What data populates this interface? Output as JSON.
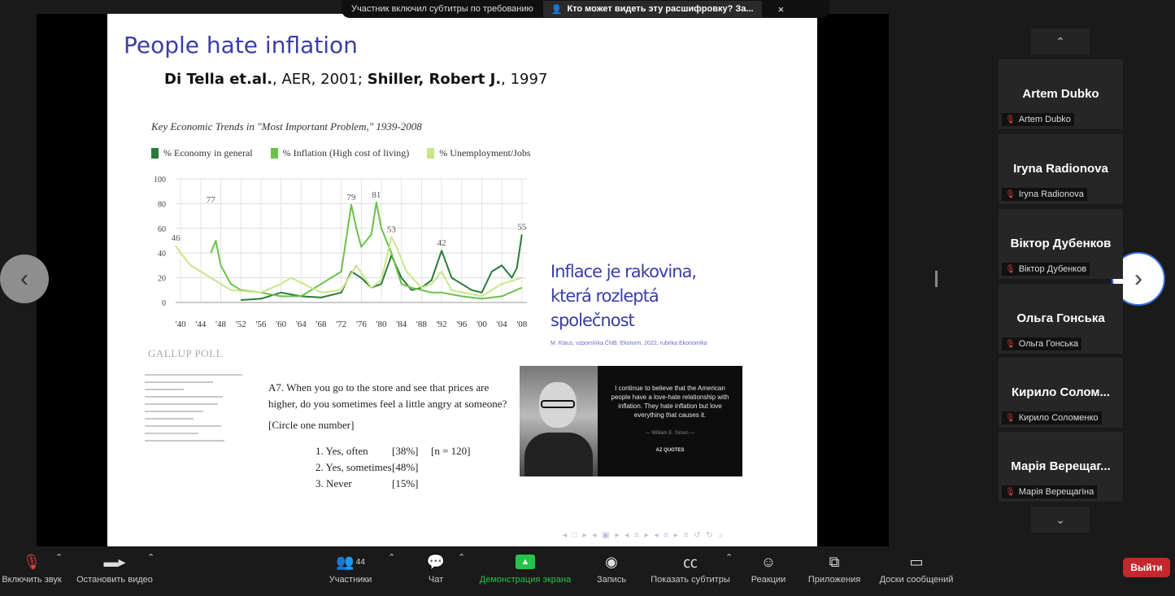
{
  "topbar": {
    "captions_notice": "Участник включил субтитры по требованию",
    "transcript_who": "Кто может видеть эту расшифровку? За...",
    "close": "×"
  },
  "slide": {
    "title": "People hate inflation",
    "subtitle_a1": "Di Tella et.al.",
    "subtitle_a2": ", AER, 2001; ",
    "subtitle_b1": "Shiller, Robert J.",
    "subtitle_b2": ", 1997",
    "gallup": "GALLUP POLL",
    "survey_q": "A7. When you go to the store and see that prices are higher, do you sometimes feel a little angry at someone?",
    "survey_instr": "[Circle one number]",
    "survey_opts": [
      {
        "label": "1. Yes, often",
        "pct": "[38%]",
        "n": "[n = 120]"
      },
      {
        "label": "2. Yes, sometimes",
        "pct": "[48%]",
        "n": ""
      },
      {
        "label": "3. Never",
        "pct": "[15%]",
        "n": ""
      }
    ],
    "czech_quote": "Inflace je rakovina, která rozleptá společnost",
    "czech_source": "M. Klaus, vzpomínka ČNB, Ekonom, 2022, rubrika Ekonomika",
    "quote_text": "I continue to believe that the American people have a love-hate relationship with inflation. They hate inflation but love everything that causes it.",
    "quote_author": "— William E. Simon —",
    "quote_brand": "AZ QUOTES"
  },
  "chart_data": {
    "type": "line",
    "title": "Key Economic Trends in \"Most Important Problem,\" 1939-2008",
    "series_colors": [
      "#2b7a3a",
      "#6cc04a",
      "#c8e68a"
    ],
    "series": [
      {
        "name": "% Economy in general",
        "x": [
          1952,
          1956,
          1960,
          1964,
          1968,
          1972,
          1974,
          1976,
          1978,
          1980,
          1982,
          1984,
          1986,
          1988,
          1990,
          1991,
          1992,
          1994,
          1996,
          1998,
          2000,
          2002,
          2004,
          2006,
          2007,
          2008
        ],
        "values": [
          2,
          3,
          8,
          5,
          4,
          8,
          25,
          20,
          12,
          15,
          38,
          20,
          10,
          12,
          18,
          30,
          42,
          20,
          15,
          10,
          8,
          25,
          30,
          20,
          28,
          55
        ]
      },
      {
        "name": "% Inflation (High cost of living)",
        "x": [
          1946,
          1947,
          1948,
          1950,
          1952,
          1956,
          1960,
          1964,
          1968,
          1972,
          1974,
          1975,
          1976,
          1978,
          1979,
          1980,
          1982,
          1984,
          1986,
          1988,
          1990,
          1992,
          1996,
          2000,
          2004,
          2008
        ],
        "values": [
          40,
          50,
          30,
          15,
          10,
          8,
          5,
          5,
          15,
          25,
          79,
          60,
          45,
          55,
          81,
          60,
          40,
          15,
          12,
          10,
          8,
          8,
          5,
          3,
          5,
          12
        ]
      },
      {
        "name": "% Unemployment/Jobs",
        "x": [
          1939,
          1940,
          1942,
          1946,
          1950,
          1956,
          1960,
          1962,
          1968,
          1972,
          1975,
          1978,
          1980,
          1982,
          1983,
          1985,
          1988,
          1990,
          1992,
          1994,
          2000,
          2004,
          2008
        ],
        "values": [
          46,
          40,
          30,
          20,
          10,
          8,
          15,
          20,
          8,
          10,
          30,
          12,
          18,
          53,
          45,
          25,
          12,
          15,
          25,
          10,
          5,
          15,
          20
        ]
      }
    ],
    "annotations": [
      {
        "x": 1939,
        "y": 46,
        "label": "46"
      },
      {
        "x": 1946,
        "y": 77,
        "label": "77"
      },
      {
        "x": 1974,
        "y": 79,
        "label": "79"
      },
      {
        "x": 1979,
        "y": 81,
        "label": "81"
      },
      {
        "x": 1982,
        "y": 53,
        "label": "53"
      },
      {
        "x": 1992,
        "y": 42,
        "label": "42"
      },
      {
        "x": 2008,
        "y": 55,
        "label": "55"
      }
    ],
    "xticks": [
      "'40",
      "'44",
      "'48",
      "'52",
      "'56",
      "'60",
      "'64",
      "'68",
      "'72",
      "'76",
      "'80",
      "'84",
      "'88",
      "'92",
      "'96",
      "'00",
      "'04",
      "'08"
    ],
    "xtick_years": [
      1940,
      1944,
      1948,
      1952,
      1956,
      1960,
      1964,
      1968,
      1972,
      1976,
      1980,
      1984,
      1988,
      1992,
      1996,
      2000,
      2004,
      2008
    ],
    "yticks": [
      0,
      20,
      40,
      60,
      80,
      100
    ],
    "xlim": [
      1939,
      2009
    ],
    "ylim": [
      0,
      100
    ],
    "grid": true
  },
  "participants": [
    {
      "display": "Artem Dubko",
      "tag": "Artem Dubko"
    },
    {
      "display": "Iryna Radionova",
      "tag": "Iryna Radionova"
    },
    {
      "display": "Віктор Дубенков",
      "tag": "Віктор Дубенков"
    },
    {
      "display": "Ольга Гонська",
      "tag": "Ольга Гонська"
    },
    {
      "display": "Кирило Солом...",
      "tag": "Кирило Соломенко"
    },
    {
      "display": "Марія Верещаг...",
      "tag": "Марія Верещагіна"
    }
  ],
  "toolbar": {
    "audio": "Включить звук",
    "video": "Остановить видео",
    "participants": "Участники",
    "participants_count": "44",
    "chat": "Чат",
    "share": "Демонстрация экрана",
    "record": "Запись",
    "captions": "Показать субтитры",
    "reactions": "Реакции",
    "apps": "Приложения",
    "whiteboard": "Доски сообщений",
    "leave": "Выйти"
  }
}
